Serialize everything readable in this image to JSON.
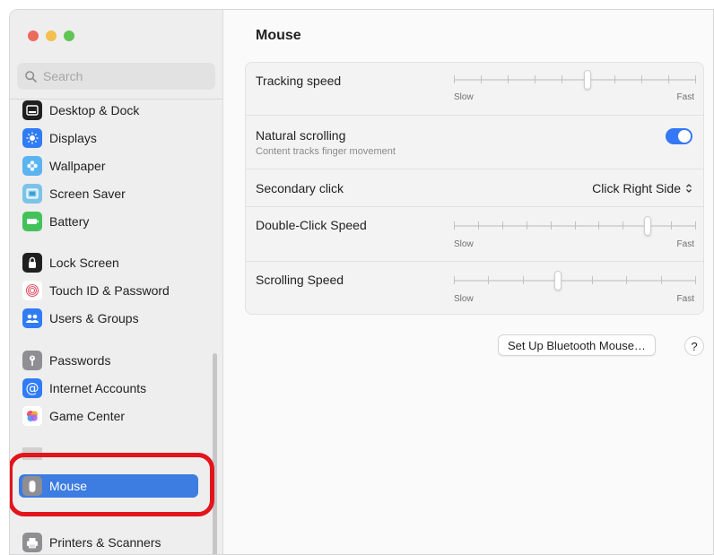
{
  "window_title": "Mouse",
  "sidebar": {
    "search_placeholder": "Search",
    "items": [
      {
        "label": "Desktop & Dock"
      },
      {
        "label": "Displays"
      },
      {
        "label": "Wallpaper"
      },
      {
        "label": "Screen Saver"
      },
      {
        "label": "Battery"
      },
      {
        "label": "Lock Screen"
      },
      {
        "label": "Touch ID & Password"
      },
      {
        "label": "Users & Groups"
      },
      {
        "label": "Passwords"
      },
      {
        "label": "Internet Accounts"
      },
      {
        "label": "Game Center"
      },
      {
        "label": "Mouse"
      },
      {
        "label": "Printers & Scanners"
      }
    ],
    "selected": "Mouse"
  },
  "settings": {
    "tracking_speed": {
      "label": "Tracking speed",
      "min_label": "Slow",
      "max_label": "Fast",
      "value": 0.55
    },
    "natural_scrolling": {
      "label": "Natural scrolling",
      "sublabel": "Content tracks finger movement",
      "enabled": true
    },
    "secondary_click": {
      "label": "Secondary click",
      "value": "Click Right Side"
    },
    "double_click_speed": {
      "label": "Double-Click Speed",
      "min_label": "Slow",
      "max_label": "Fast",
      "value": 0.8
    },
    "scrolling_speed": {
      "label": "Scrolling Speed",
      "min_label": "Slow",
      "max_label": "Fast",
      "value": 0.43
    }
  },
  "footer": {
    "bluetooth_button": "Set Up Bluetooth Mouse…",
    "help_button": "?"
  },
  "colors": {
    "accent": "#3478f6",
    "selection": "#3d7ce0",
    "highlight_ring": "#e3141b"
  }
}
